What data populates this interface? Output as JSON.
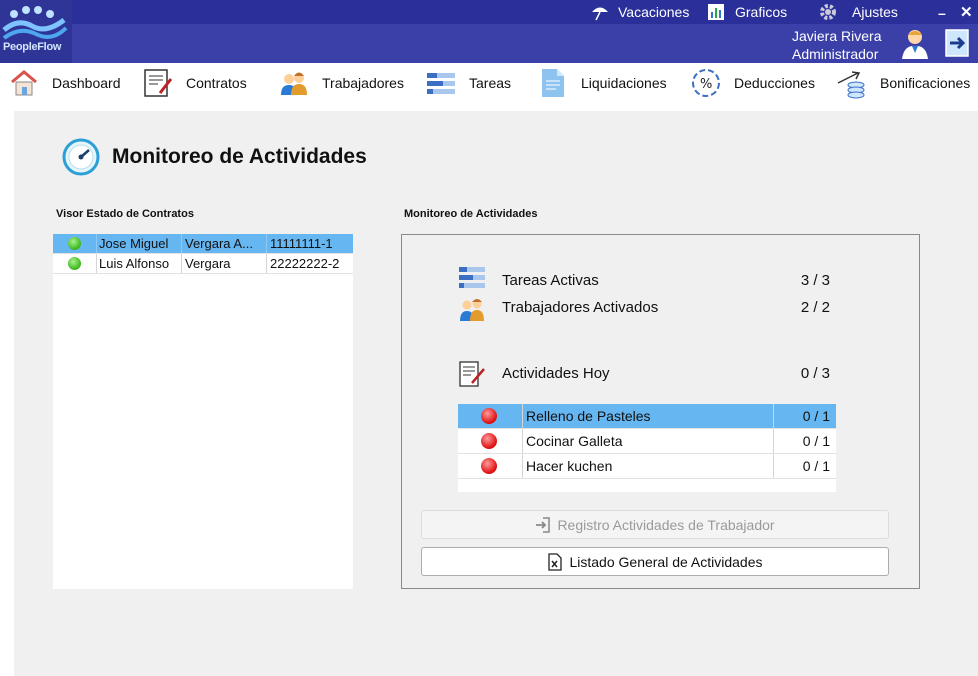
{
  "app": {
    "logo_text": "PeopleFlow"
  },
  "topmenu": {
    "vacaciones": "Vacaciones",
    "graficos": "Graficos",
    "ajustes": "Ajustes"
  },
  "window": {
    "minimize": "–",
    "close": "✕"
  },
  "user": {
    "name": "Javiera Rivera",
    "role": "Administrador"
  },
  "nav": [
    {
      "label": "Dashboard"
    },
    {
      "label": "Contratos"
    },
    {
      "label": "Trabajadores"
    },
    {
      "label": "Tareas"
    },
    {
      "label": "Liquidaciones"
    },
    {
      "label": "Deducciones"
    },
    {
      "label": "Bonificaciones"
    }
  ],
  "page": {
    "title": "Monitoreo de Actividades"
  },
  "contracts": {
    "label": "Visor Estado de Contratos",
    "rows": [
      {
        "first": "Jose Miguel",
        "last": "Vergara A...",
        "rut": "11111111-1",
        "status": "active",
        "selected": true
      },
      {
        "first": "Luis Alfonso",
        "last": "Vergara",
        "rut": "22222222-2",
        "status": "active",
        "selected": false
      }
    ]
  },
  "monitor": {
    "label": "Monitoreo de Actividades",
    "tareas": {
      "label": "Tareas Activas",
      "value": "3 / 3"
    },
    "trabajadores": {
      "label": "Trabajadores Activados",
      "value": "2 / 2"
    },
    "hoy": {
      "label": "Actividades Hoy",
      "value": "0 / 3"
    },
    "activities": [
      {
        "name": "Relleno de Pasteles",
        "value": "0 / 1",
        "selected": true
      },
      {
        "name": "Cocinar Galleta",
        "value": "0 / 1",
        "selected": false
      },
      {
        "name": "Hacer kuchen",
        "value": "0 / 1",
        "selected": false
      }
    ],
    "btn_registro": "Registro Actividades de Trabajador",
    "btn_listado": "Listado General de Actividades"
  },
  "colors": {
    "topbar": "#3b40a8",
    "selection": "#66b6f2",
    "status_active": "#3ab51d",
    "status_inactive": "#e01414"
  }
}
